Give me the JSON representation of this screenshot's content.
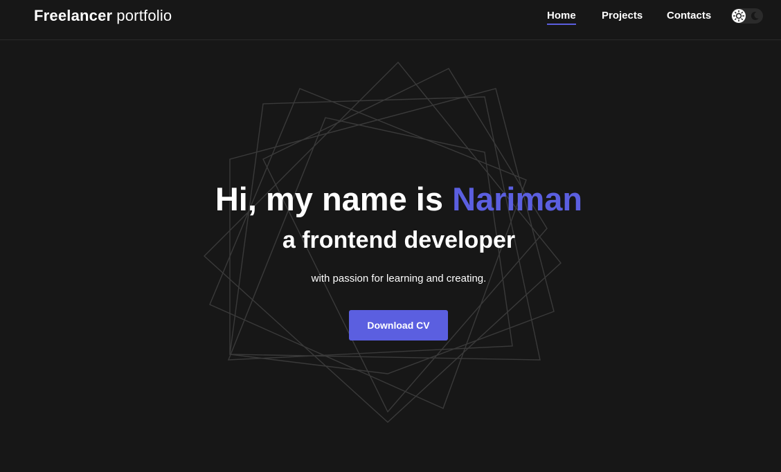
{
  "header": {
    "logo_bold": "Freelancer",
    "logo_light": "portfolio",
    "nav": [
      {
        "label": "Home",
        "active": true
      },
      {
        "label": "Projects",
        "active": false
      },
      {
        "label": "Contacts",
        "active": false
      }
    ],
    "theme_toggle": {
      "left_icon": "sun-icon",
      "right_icon": "moon-icon",
      "mode": "dark"
    }
  },
  "hero": {
    "greeting": "Hi, my name is ",
    "name": "Nariman",
    "role": "a frontend developer",
    "tagline": "with passion for learning and creating.",
    "cta_label": "Download CV"
  },
  "colors": {
    "background": "#171717",
    "accent": "#5b5fe0",
    "text": "#ffffff",
    "decor_lines": "#3a3a3a"
  },
  "decoration": {
    "type": "rotated-squares-outline"
  }
}
